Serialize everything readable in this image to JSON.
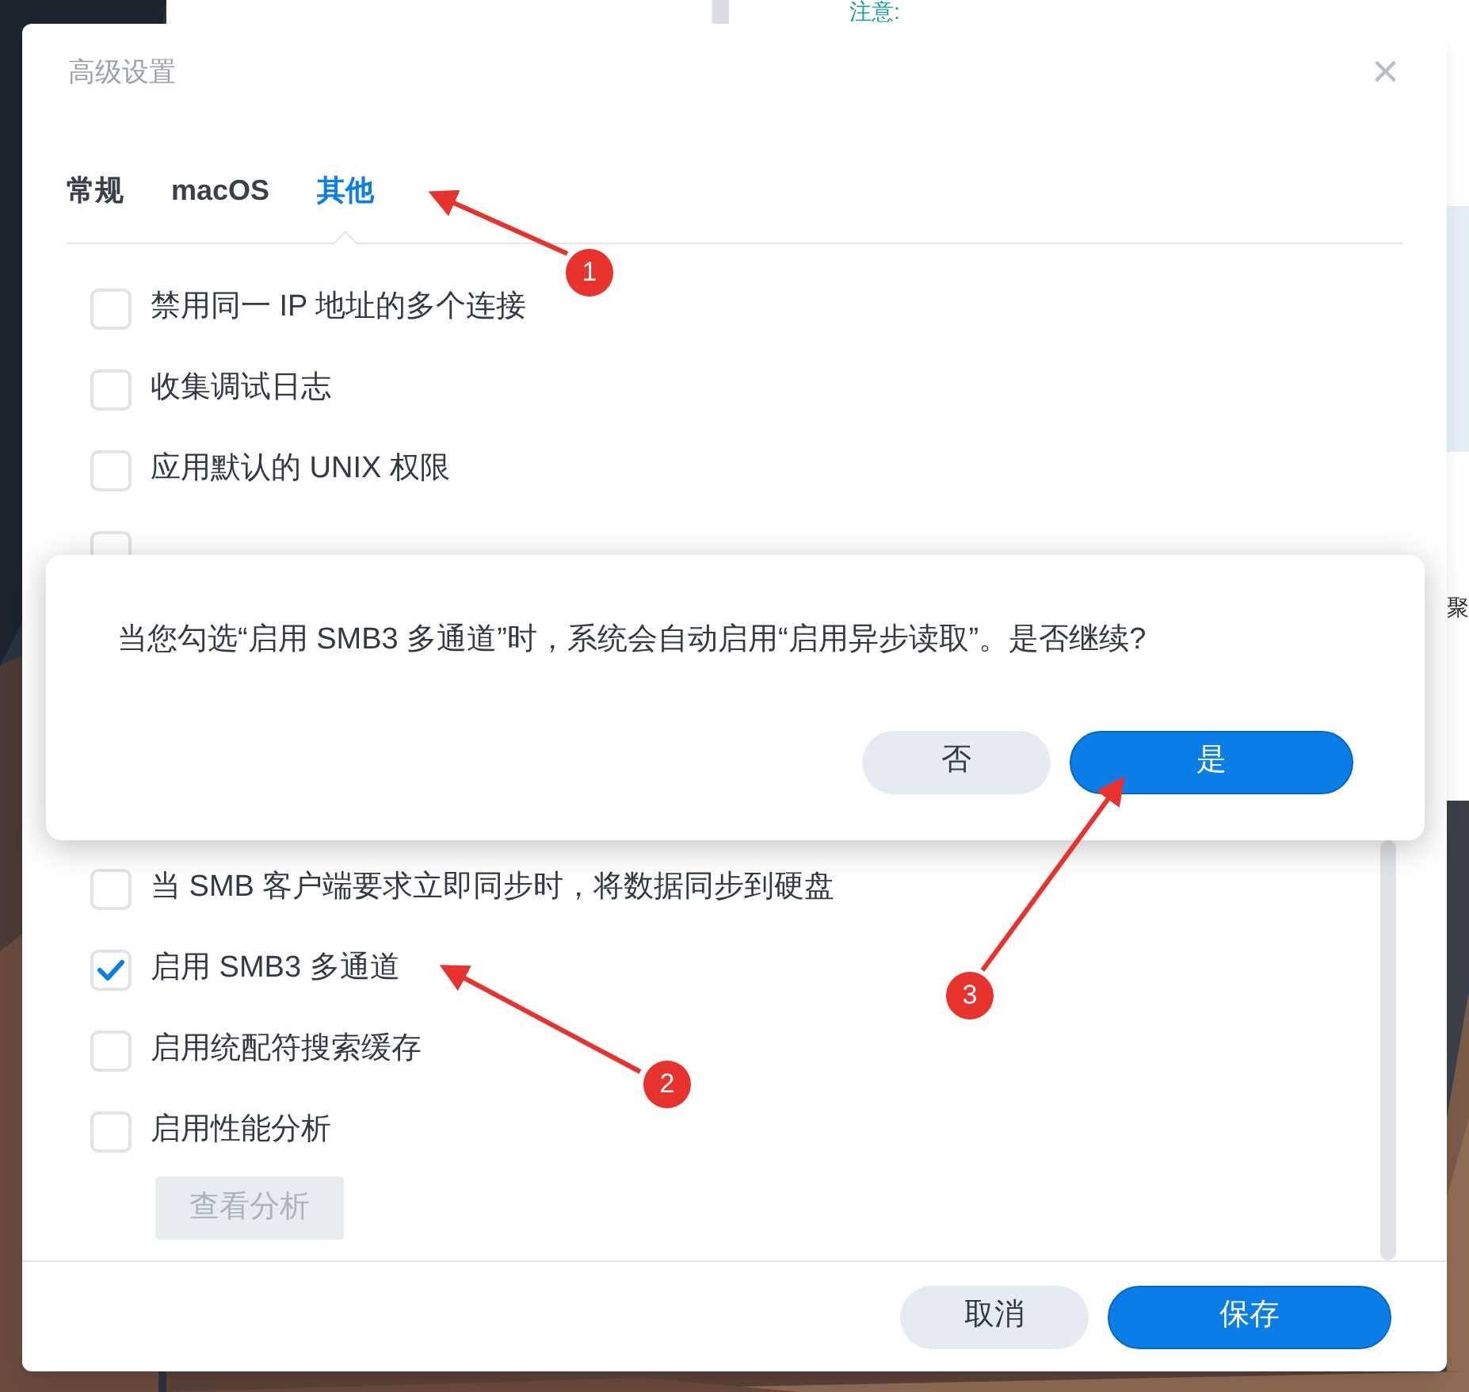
{
  "background_window": {
    "note_label": "注意:",
    "side_text": "聚"
  },
  "dialog": {
    "title": "高级设置",
    "close": "×",
    "tabs": [
      {
        "label": "常规",
        "selected": false
      },
      {
        "label": "macOS",
        "selected": false
      },
      {
        "label": "其他",
        "selected": true
      }
    ],
    "options_top": [
      {
        "label": "禁用同一 IP 地址的多个连接",
        "checked": false
      },
      {
        "label": "收集调试日志",
        "checked": false
      },
      {
        "label": "应用默认的 UNIX 权限",
        "checked": false
      }
    ],
    "covered_option": {
      "checked": false
    },
    "options_bottom": [
      {
        "label": "当 SMB 客户端要求立即同步时，将数据同步到硬盘",
        "checked": false
      },
      {
        "label": "启用 SMB3 多通道",
        "checked": true
      },
      {
        "label": "启用统配符搜索缓存",
        "checked": false
      },
      {
        "label": "启用性能分析",
        "checked": false
      }
    ],
    "view_analysis_button": {
      "label": "查看分析",
      "disabled": true
    },
    "buttons": [
      {
        "label": "取消",
        "kind": "secondary"
      },
      {
        "label": "保存",
        "kind": "primary"
      }
    ]
  },
  "confirm": {
    "message": "当您勾选“启用 SMB3 多通道”时，系统会自动启用“启用异步读取”。是否继续?",
    "buttons": [
      {
        "label": "否",
        "kind": "secondary"
      },
      {
        "label": "是",
        "kind": "primary"
      }
    ]
  },
  "annotations": [
    {
      "label": "1"
    },
    {
      "label": "2"
    },
    {
      "label": "3"
    }
  ]
}
